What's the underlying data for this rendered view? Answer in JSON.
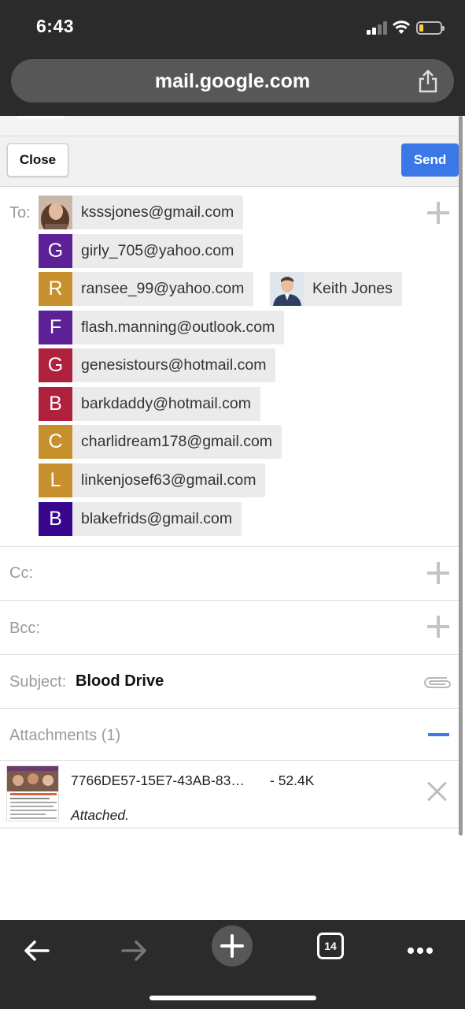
{
  "status": {
    "time": "6:43"
  },
  "browser": {
    "url": "mail.google.com",
    "tab_count": "14"
  },
  "toolbar": {
    "close_label": "Close",
    "send_label": "Send"
  },
  "compose": {
    "to_label": "To:",
    "cc_label": "Cc:",
    "bcc_label": "Bcc:",
    "subject_label": "Subject:",
    "subject_value": "Blood Drive",
    "attachments_label": "Attachments (1)",
    "recipients": [
      {
        "initial": "",
        "email": "ksssjones@gmail.com",
        "avatar": "photo",
        "color": "#b08a78"
      },
      {
        "initial": "G",
        "email": "girly_705@yahoo.com",
        "color": "#5e2096"
      },
      {
        "initial": "R",
        "email": "ransee_99@yahoo.com",
        "color": "#c8902c"
      },
      {
        "initial": "",
        "email": "Keith Jones",
        "avatar": "photo",
        "color": "#3a5a8a"
      },
      {
        "initial": "F",
        "email": "flash.manning@outlook.com",
        "color": "#5e2096"
      },
      {
        "initial": "G",
        "email": "genesistours@hotmail.com",
        "color": "#b0213e"
      },
      {
        "initial": "B",
        "email": "barkdaddy@hotmail.com",
        "color": "#b0213e"
      },
      {
        "initial": "C",
        "email": "charlidream178@gmail.com",
        "color": "#c8902c"
      },
      {
        "initial": "L",
        "email": "linkenjosef63@gmail.com",
        "color": "#c8902c"
      },
      {
        "initial": "B",
        "email": "blakefrids@gmail.com",
        "color": "#37088e"
      }
    ],
    "attachment": {
      "filename": "7766DE57-15E7-43AB-83…",
      "size": "- 52.4K",
      "status": "Attached."
    }
  }
}
